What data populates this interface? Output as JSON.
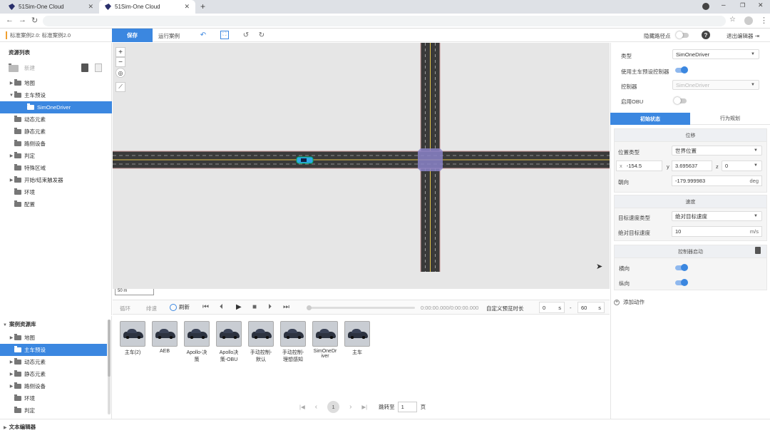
{
  "browser": {
    "tabs": [
      {
        "title": "51Sim-One Cloud",
        "active": false
      },
      {
        "title": "51Sim-One Cloud",
        "active": true
      }
    ],
    "new_tab": "+"
  },
  "header": {
    "breadcrumb": "标准案例2.0: 标准案例2.0",
    "save_label": "保存",
    "run_label": "运行案例",
    "hide_waypoints_label": "隐藏路径点",
    "help_label": "?",
    "exit_label": "退出编辑器"
  },
  "resources": {
    "title": "资源列表",
    "new_label": "新建",
    "items": [
      {
        "label": "地图",
        "level": 0,
        "caret": "▶",
        "selected": false,
        "icon": "folder-icon"
      },
      {
        "label": "主车预设",
        "level": 0,
        "caret": "▼",
        "selected": false,
        "icon": "folder-open-icon"
      },
      {
        "label": "SimOneDriver",
        "level": 1,
        "caret": "",
        "selected": true,
        "icon": "car-icon"
      },
      {
        "label": "动态元素",
        "level": 0,
        "caret": "",
        "selected": false,
        "icon": "folder-icon"
      },
      {
        "label": "静态元素",
        "level": 0,
        "caret": "",
        "selected": false,
        "icon": "folder-icon"
      },
      {
        "label": "路侧设备",
        "level": 0,
        "caret": "",
        "selected": false,
        "icon": "folder-icon"
      },
      {
        "label": "判定",
        "level": 0,
        "caret": "▶",
        "selected": false,
        "icon": "folder-icon"
      },
      {
        "label": "特殊区域",
        "level": 0,
        "caret": "",
        "selected": false,
        "icon": "folder-icon"
      },
      {
        "label": "开始/结束触发器",
        "level": 0,
        "caret": "▶",
        "selected": false,
        "icon": "folder-icon"
      },
      {
        "label": "环境",
        "level": 0,
        "caret": "",
        "selected": false,
        "icon": "environment-icon"
      },
      {
        "label": "配置",
        "level": 0,
        "caret": "",
        "selected": false,
        "icon": "config-icon"
      }
    ]
  },
  "map": {
    "scale_label": "50 m",
    "zoom_in": "+",
    "zoom_out": "−"
  },
  "playback": {
    "loop_label": "循环",
    "follow_label": "绯速",
    "refresh_label": "刷新",
    "time_label": "0:00:00.000/0:00:00.000",
    "custom_duration_label": "自定义预览时长",
    "start_value": "0",
    "end_value": "60",
    "unit": "s",
    "separator": "-"
  },
  "right": {
    "type_label": "类型",
    "type_value": "SimOneDriver",
    "use_preset_label": "使用主车预设控制器",
    "controller_label": "控制器",
    "controller_value": "SimOneDriver",
    "obu_label": "启用OBU",
    "tabs": [
      "初始状态",
      "行为规划"
    ],
    "position_card": {
      "title": "位移",
      "pos_type_label": "位置类型",
      "pos_type_value": "世界位置",
      "x_label": "x",
      "x_value": "-154.5",
      "y_label": "y",
      "y_value": "3.695637",
      "z_label": "z",
      "z_value": "0",
      "heading_label": "朝向",
      "heading_value": "-179.999983",
      "heading_unit": "deg"
    },
    "speed_card": {
      "title": "速度",
      "target_type_label": "目标速度类型",
      "target_type_value": "绝对目标速度",
      "abs_speed_label": "绝对目标速度",
      "abs_speed_value": "10",
      "abs_speed_unit": "m/s"
    },
    "controller_card": {
      "title": "控制器启动",
      "lateral_label": "横向",
      "longitudinal_label": "纵向"
    },
    "add_action_label": "添加动作"
  },
  "library": {
    "title": "案例资源库",
    "items": [
      {
        "label": "地图",
        "caret": "▶",
        "selected": false
      },
      {
        "label": "主车预设",
        "caret": "",
        "selected": true
      },
      {
        "label": "动态元素",
        "caret": "▶",
        "selected": false
      },
      {
        "label": "静态元素",
        "caret": "▶",
        "selected": false
      },
      {
        "label": "路侧设备",
        "caret": "▶",
        "selected": false
      },
      {
        "label": "环境",
        "caret": "",
        "selected": false
      },
      {
        "label": "判定",
        "caret": "",
        "selected": false
      }
    ],
    "vehicles": [
      {
        "line1": "主车(2)",
        "line2": ""
      },
      {
        "line1": "AEB",
        "line2": ""
      },
      {
        "line1": "Apollo-决",
        "line2": "策"
      },
      {
        "line1": "Apollo决",
        "line2": "策-OBU"
      },
      {
        "line1": "手动控制-",
        "line2": "默认"
      },
      {
        "line1": "手动控制-",
        "line2": "理想感知"
      },
      {
        "line1": "SimOneDr",
        "line2": "iver"
      },
      {
        "line1": "主车",
        "line2": ""
      }
    ]
  },
  "pager": {
    "first": "|◀",
    "prev": "‹",
    "page": "1",
    "next": "›",
    "last": "▶|",
    "jump_label": "跳转至",
    "jump_value": "1",
    "page_unit": "页"
  },
  "bottom": {
    "text_editor_label": "文本编辑器"
  }
}
